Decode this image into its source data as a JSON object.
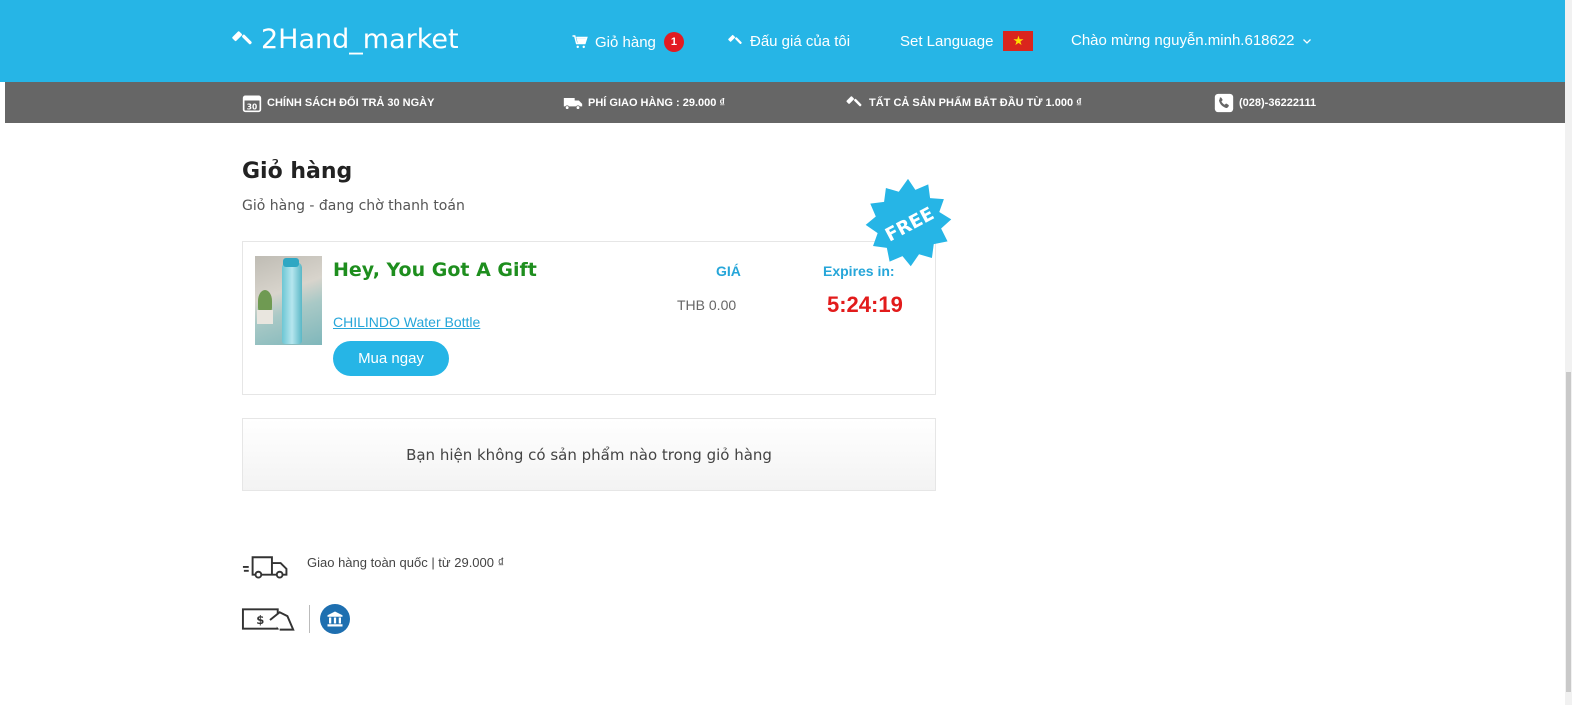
{
  "header": {
    "logo_text": "2Hand_market",
    "logo_icon": "gavel-icon",
    "cart_label": "Giỏ hàng",
    "cart_count": "1",
    "auction_label": "Đấu giá của tôi",
    "language_label": "Set Language",
    "flag_symbol": "★",
    "greeting": "Chào mừng nguyễn.minh.618622"
  },
  "infobar": {
    "returns": "CHÍNH SÁCH ĐỔI TRẢ 30 NGÀY",
    "shipping_fee": "PHÍ GIAO HÀNG : 29.000 ₫",
    "all_products": "TẤT CẢ SẢN PHẨM BẮT ĐẦU TỪ 1.000 ₫",
    "phone": "(028)-36222111"
  },
  "page": {
    "title": "Giỏ hàng",
    "subtitle": "Giỏ hàng - đang chờ thanh toán"
  },
  "gift": {
    "badge": "FREE",
    "title": "Hey, You Got A Gift",
    "product_link": "CHILINDO Water Bottle",
    "buy_button": "Mua ngay",
    "price_label": "GIÁ",
    "price_value": "THB 0.00",
    "expires_label": "Expires in:",
    "expires_value": "5:24:19"
  },
  "empty_cart": {
    "message": "Bạn hiện không có sản phẩm nào trong giỏ hàng"
  },
  "footer_info": {
    "shipping_text": "Giao hàng toàn quốc | từ 29.000 ₫"
  },
  "colors": {
    "brand": "#26b5e6",
    "infobar": "#666666",
    "gift_title": "#1e8e1e",
    "timer": "#e21b1b",
    "badge": "#e21b22"
  }
}
